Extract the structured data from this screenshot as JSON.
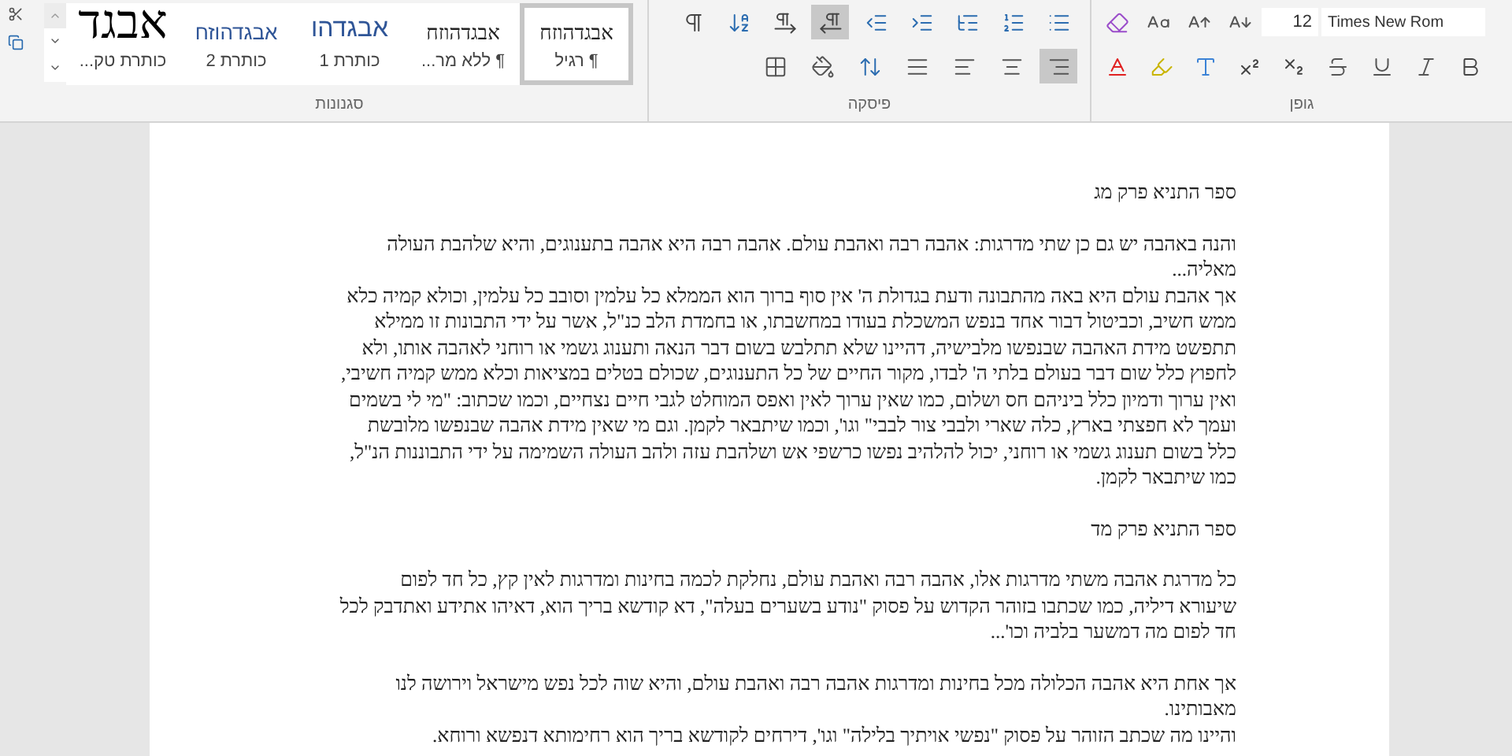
{
  "ribbon": {
    "styles": {
      "label": "סגנונות",
      "items": [
        {
          "preview": "אבגדהוזח",
          "name": "¶ רגיל",
          "kind": "normal",
          "selected": true
        },
        {
          "preview": "אבגדהוזח",
          "name": "¶ ללא מר...",
          "kind": "normal",
          "selected": false
        },
        {
          "preview": "אבגדהו",
          "name": "כותרת 1",
          "kind": "heading1",
          "selected": false
        },
        {
          "preview": "אבגדהוזח",
          "name": "כותרת 2",
          "kind": "heading2",
          "selected": false
        },
        {
          "preview": "אבגד",
          "name": "כותרת טק...",
          "kind": "title",
          "selected": false
        }
      ]
    },
    "paragraph": {
      "label": "פיסקה",
      "row1": [
        {
          "kind": "pilcrow",
          "selected": false
        },
        {
          "kind": "sort",
          "selected": false
        },
        {
          "kind": "ltr",
          "selected": false
        },
        {
          "kind": "rtl",
          "selected": true
        },
        {
          "kind": "indent-decrease",
          "selected": false
        },
        {
          "kind": "indent-increase",
          "selected": false
        },
        {
          "kind": "multilevel",
          "selected": false
        },
        {
          "kind": "numbering",
          "selected": false
        },
        {
          "kind": "bullets",
          "selected": false
        }
      ],
      "row2": [
        {
          "kind": "borders",
          "selected": false
        },
        {
          "kind": "shading",
          "selected": false
        },
        {
          "kind": "line-spacing",
          "selected": false
        },
        {
          "kind": "justify",
          "selected": false
        },
        {
          "kind": "align-left",
          "selected": false
        },
        {
          "kind": "center",
          "selected": false
        },
        {
          "kind": "align-right",
          "selected": true
        }
      ]
    },
    "font": {
      "label": "גופן",
      "font_size": "12",
      "font_name": "Times New Rom",
      "row1": [
        {
          "kind": "clear",
          "selected": false
        },
        {
          "kind": "case",
          "selected": false
        },
        {
          "kind": "grow",
          "selected": false
        },
        {
          "kind": "shrink",
          "selected": false
        }
      ],
      "row2": [
        {
          "kind": "font-color",
          "selected": false
        },
        {
          "kind": "highlight",
          "selected": false
        },
        {
          "kind": "effects",
          "selected": false
        },
        {
          "kind": "superscript",
          "selected": false
        },
        {
          "kind": "subscript",
          "selected": false
        },
        {
          "kind": "strike",
          "selected": false
        },
        {
          "kind": "underline",
          "selected": false
        },
        {
          "kind": "italic",
          "selected": false
        },
        {
          "kind": "bold",
          "selected": false
        }
      ]
    }
  },
  "document": {
    "paragraphs": [
      {
        "kind": "heading",
        "text": "ספר התניא פרק מג"
      },
      {
        "kind": "body",
        "text": "והנה באהבה יש גם כן שתי מדרגות: אהבה רבה ואהבת עולם. אהבה רבה היא אהבה בתענוגים, והיא שלהבת העולה מאליה..."
      },
      {
        "kind": "body",
        "text": "אך אהבת עולם היא באה מהתבונה ודעת בגדולת ה' אין סוף ברוך הוא הממלא כל עלמין וסובב כל עלמין, וכולא קמיה כלא ממש חשיב, וכביטול דבור אחד בנפש המשכלת בעודו במחשבתו, או בחמדת הלב כנ\"ל, אשר על ידי התבונות זו ממילא תתפשט מידת האהבה שבנפשו מלבישיה, דהיינו שלא תתלבש בשום דבר הנאה ותענוג גשמי או רוחני לאהבה אותו, ולא לחפוץ כלל שום דבר בעולם בלתי ה' לבדו, מקור החיים של כל התענוגים, שכולם בטלים במציאות וכלא ממש קמיה חשיבי, ואין ערוך ודמיון כלל ביניהם חס ושלום, כמו שאין ערוך לאין ואפס המוחלט לגבי חיים נצחיים, וכמו שכתוב: \"מי לי בשמים ועמך לא חפצתי בארץ, כלה שארי ולבבי צור לבבי\" וגו', וכמו שיתבאר לקמן. וגם מי שאין מידת אהבה שבנפשו מלובשת כלל בשום תענוג גשמי או רוחני, יכול להלהיב נפשו כרשפי אש ושלהבת עזה ולהב העולה השמימה על ידי התבוננות הנ\"ל, כמו שיתבאר לקמן.",
        "gap_after": true
      },
      {
        "kind": "heading",
        "text": "ספר התניא פרק מד"
      },
      {
        "kind": "body",
        "text": "כל מדרגת אהבה משתי מדרגות אלו, אהבה רבה ואהבת עולם, נחלקת לכמה בחינות ומדרגות לאין קץ, כל חד לפום שיעורא דיליה, כמו שכתבו בזוהר הקדוש על פסוק \"נודע בשערים בעלה\", דא קודשא בריך הוא, דאיהו אתידע ואתדבק לכל חד לפום מה דמשער בלביה וכו'...",
        "gap_after": true
      },
      {
        "kind": "body",
        "text": "אך אחת היא אהבה הכלולה מכל בחינות ומדרגות אהבה רבה ואהבת עולם, והיא שוה לכל נפש מישראל וירושה לנו מאבותינו."
      },
      {
        "kind": "body",
        "text": "והיינו מה שכתב הזוהר על פסוק \"נפשי אויתיך בלילה\" וגו', דירחים לקודשא בריך הוא רחימותא דנפשא ורוחא."
      }
    ]
  }
}
